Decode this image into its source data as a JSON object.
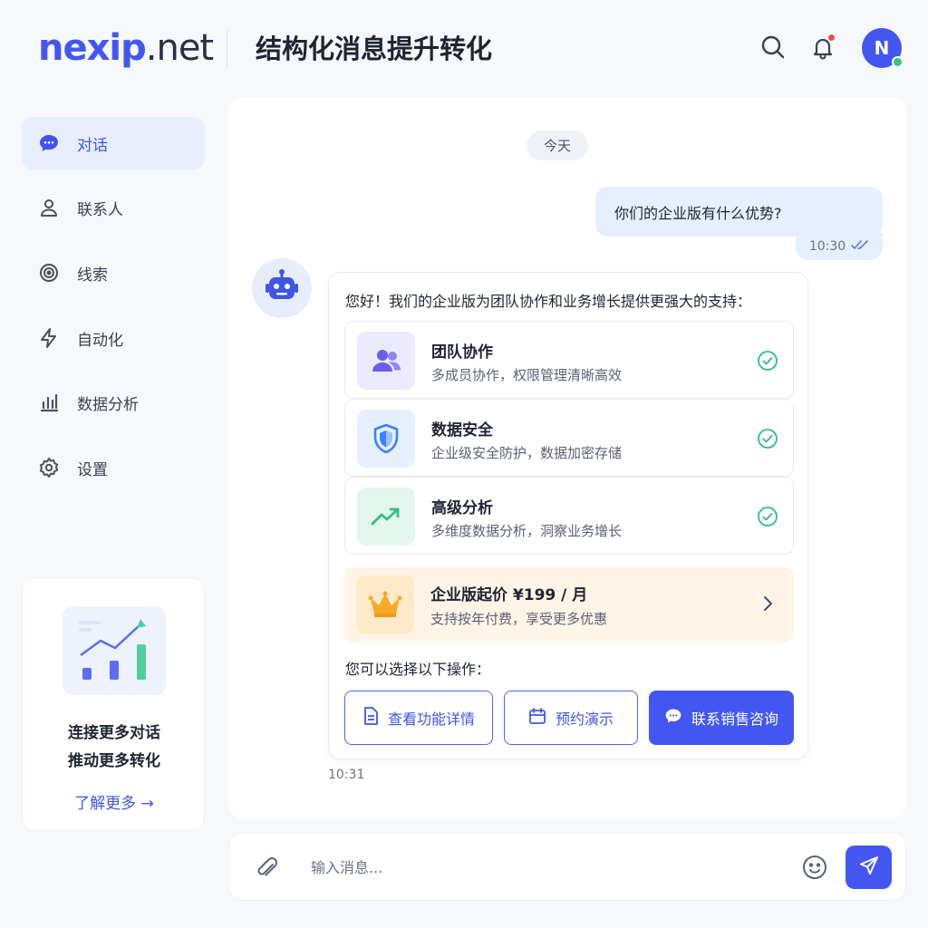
{
  "header": {
    "logo_brand": "nexip",
    "logo_tld": ".net",
    "title": "结构化消息提升转化",
    "avatar_initial": "N"
  },
  "sidebar": {
    "items": [
      {
        "label": "对话",
        "icon": "chat-icon",
        "active": true
      },
      {
        "label": "联系人",
        "icon": "user-icon",
        "active": false
      },
      {
        "label": "线索",
        "icon": "target-icon",
        "active": false
      },
      {
        "label": "自动化",
        "icon": "lightning-icon",
        "active": false
      },
      {
        "label": "数据分析",
        "icon": "bar-chart-icon",
        "active": false
      },
      {
        "label": "设置",
        "icon": "gear-icon",
        "active": false
      }
    ],
    "promo": {
      "line1": "连接更多对话",
      "line2": "推动更多转化",
      "link": "了解更多 →"
    }
  },
  "chat": {
    "date_label": "今天",
    "user_message": {
      "text": "你们的企业版有什么优势?",
      "time": "10:30",
      "status": "read"
    },
    "bot_message": {
      "intro": "您好！我们的企业版为团队协作和业务增长提供更强大的支持：",
      "features": [
        {
          "title": "团队协作",
          "desc": "多成员协作，权限管理清晰高效",
          "icon": "team-icon"
        },
        {
          "title": "数据安全",
          "desc": "企业级安全防护，数据加密存储",
          "icon": "shield-icon"
        },
        {
          "title": "高级分析",
          "desc": "多维度数据分析，洞察业务增长",
          "icon": "trend-up-icon"
        }
      ],
      "price": {
        "title": "企业版起价 ¥199 / 月",
        "desc": "支持按年付费，享受更多优惠",
        "icon": "crown-icon"
      },
      "actions_label": "您可以选择以下操作：",
      "actions": [
        {
          "label": "查看功能详情",
          "icon": "document-icon"
        },
        {
          "label": "预约演示",
          "icon": "calendar-icon"
        },
        {
          "label": "联系销售咨询",
          "icon": "chat-bubble-icon"
        }
      ],
      "time": "10:31"
    }
  },
  "composer": {
    "placeholder": "输入消息..."
  },
  "colors": {
    "accent": "#4357f0",
    "active_nav_bg": "#e9eefd",
    "online": "#2fc78b",
    "notification": "#ef4a4a",
    "price_bg": "#fff4e5",
    "check": "#2fbf8a"
  }
}
